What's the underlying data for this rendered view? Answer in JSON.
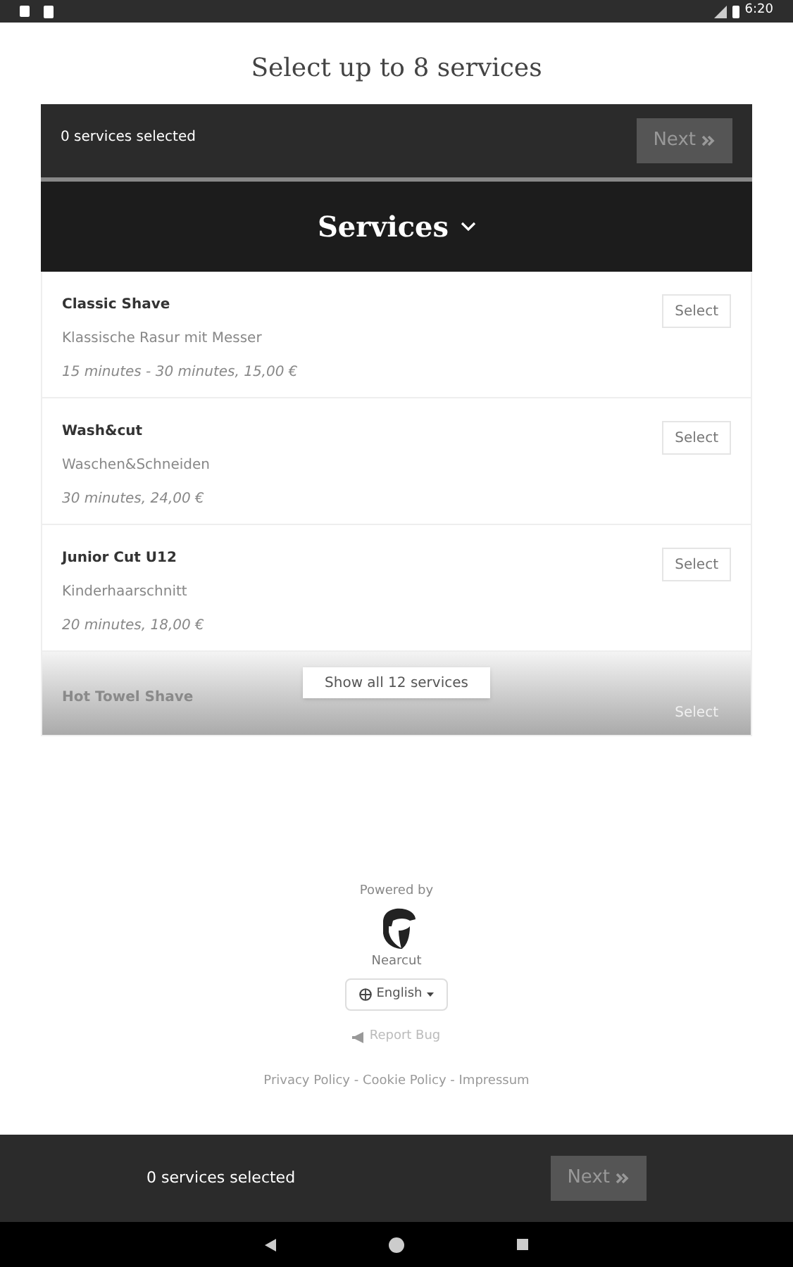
{
  "status_bar": {
    "time": "6:20"
  },
  "heading": "Select up to 8 services",
  "top_bar": {
    "count": "0 services selected",
    "next": {
      "label": "Next",
      "disabled": true
    }
  },
  "category": {
    "title": "Services",
    "expanded": true
  },
  "services": [
    {
      "name": "Classic Shave",
      "description": "Klassische Rasur mit Messer",
      "details": "15 minutes - 30 minutes, 15,00 €",
      "button": "Select",
      "faded": false
    },
    {
      "name": "Wash&cut",
      "description": "Waschen&Schneiden",
      "details": "30 minutes, 24,00 €",
      "button": "Select",
      "faded": false
    },
    {
      "name": "Junior Cut U12",
      "description": "Kinderhaarschnitt",
      "details": "20 minutes, 18,00 €",
      "button": "Select",
      "faded": false
    },
    {
      "name": "Hot Towel Shave",
      "button": "Select",
      "faded": true
    }
  ],
  "show_all": "Show all 12 services",
  "footer": {
    "powered_by": "Powered by",
    "brand": "Nearcut",
    "language": "English",
    "report": "Report Bug",
    "links": [
      "Privacy Policy",
      "Cookie Policy",
      "Impressum"
    ],
    "separator": " - "
  },
  "bottom_bar": {
    "count": "0 services selected",
    "next": {
      "label": "Next",
      "disabled": true
    }
  }
}
